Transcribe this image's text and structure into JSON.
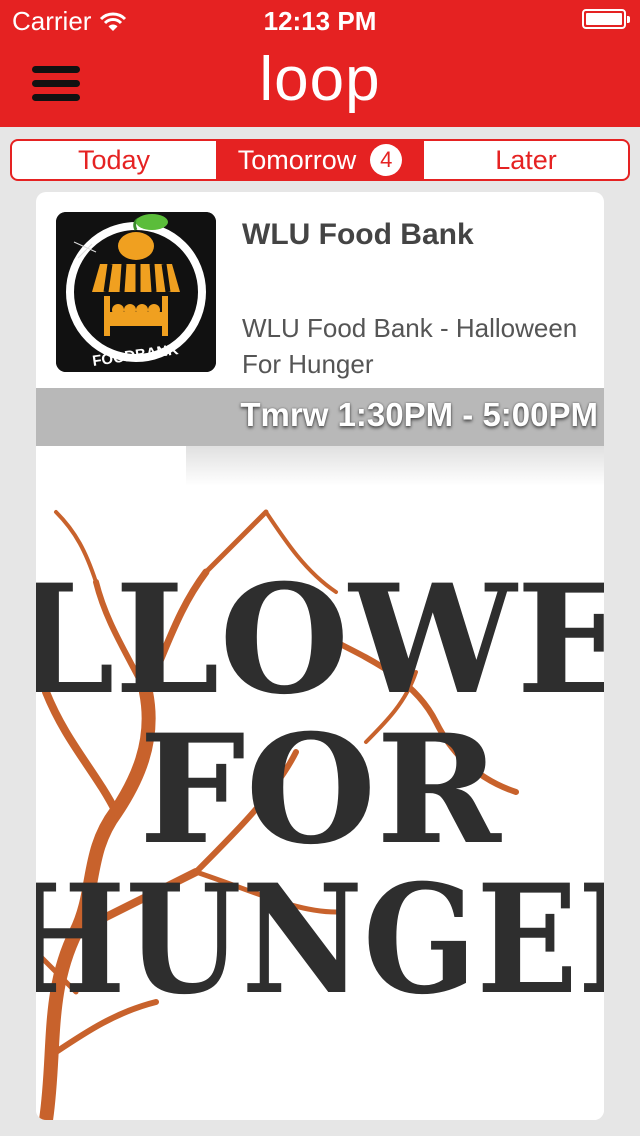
{
  "status_bar": {
    "carrier": "Carrier",
    "time": "12:13 PM"
  },
  "header": {
    "logo_text": "loop",
    "menu_icon": "hamburger-menu-icon",
    "background_color": "#e52222"
  },
  "tabs": [
    {
      "label": "Today",
      "active": false
    },
    {
      "label": "Tomorrow",
      "active": true,
      "badge": "4"
    },
    {
      "label": "Later",
      "active": false
    }
  ],
  "event_card": {
    "org_name": "WLU Food Bank",
    "description": "WLU Food Bank - Halloween For Hunger",
    "time_range": "Tmrw 1:30PM - 5:00PM",
    "thumbnail_label": "FOODBANK",
    "image_lines": [
      "LLOWE",
      "FOR",
      "HUNGEI"
    ]
  },
  "colors": {
    "accent": "#e52222",
    "background": "#e6e6e6",
    "card": "#ffffff",
    "time_band": "#b8b8b8"
  }
}
